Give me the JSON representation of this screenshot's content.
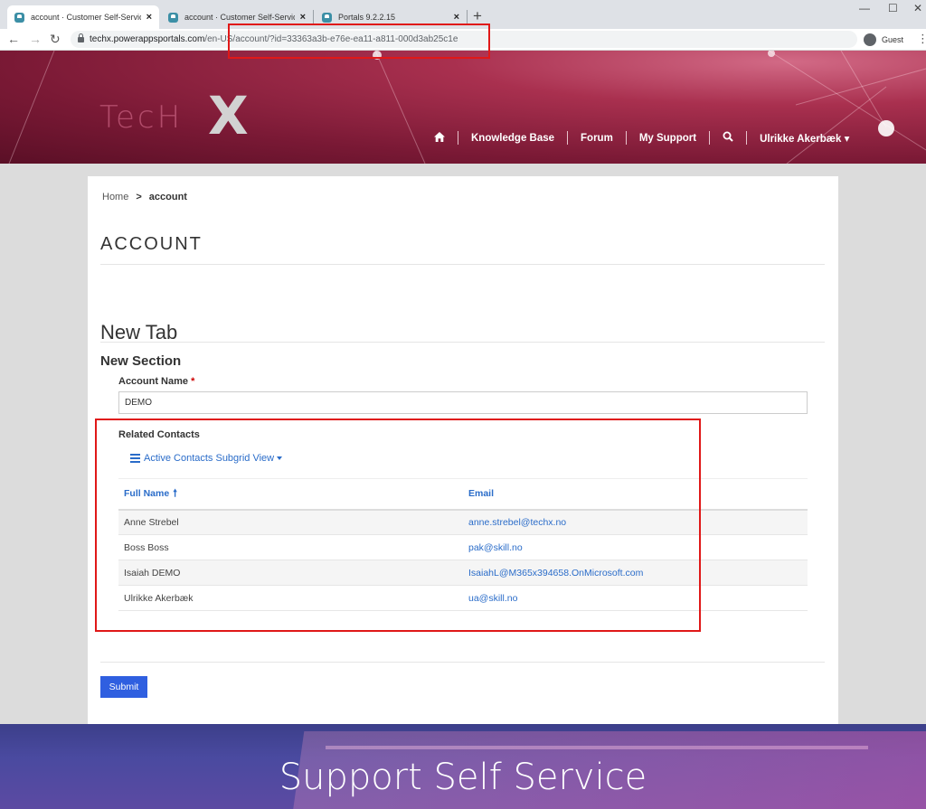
{
  "browser": {
    "tabs": [
      {
        "title": "account · Customer Self-Service",
        "close": "×"
      },
      {
        "title": "account · Customer Self-Service",
        "close": "×"
      },
      {
        "title": "Portals 9.2.2.15",
        "close": "×"
      }
    ],
    "new_tab": "+",
    "window_controls": {
      "minimize": "—",
      "maximize": "☐",
      "close": "✕"
    },
    "nav": {
      "back": "←",
      "forward": "→",
      "reload": "↻"
    },
    "url_host": "techx.powerappsportals.com",
    "url_path": "/en-US/account/?id=33363a3b-e76e-ea11-a811-000d3ab25c1e",
    "profile": "Guest",
    "menu": "⋮"
  },
  "header": {
    "logo_text": "TecH",
    "logo_x": "X",
    "nav": {
      "knowledge_base": "Knowledge Base",
      "forum": "Forum",
      "my_support": "My Support",
      "user": "Ulrikke Akerbæk ▾"
    }
  },
  "breadcrumb": {
    "home": "Home",
    "separator": ">",
    "current": "account"
  },
  "page_title": "ACCOUNT",
  "form": {
    "tab_heading": "New Tab",
    "section_heading": "New Section",
    "account_name_label": "Account Name",
    "required_mark": "*",
    "account_name_value": "DEMO",
    "related_contacts_label": "Related Contacts",
    "view_selector": "Active Contacts Subgrid View",
    "columns": {
      "full_name": "Full Name",
      "email": "Email",
      "sort": "🠕"
    },
    "rows": [
      {
        "name": "Anne Strebel",
        "email": "anne.strebel@techx.no"
      },
      {
        "name": "Boss Boss",
        "email": "pak@skill.no"
      },
      {
        "name": "Isaiah DEMO",
        "email": "IsaiahL@M365x394658.OnMicrosoft.com"
      },
      {
        "name": "Ulrikke Akerbæk",
        "email": "ua@skill.no"
      }
    ],
    "submit": "Submit"
  },
  "footer": {
    "title": "Support Self Service"
  },
  "colors": {
    "header": "#7a1935",
    "link": "#2a6cc9",
    "submit": "#2f5fe0",
    "highlight": "#e01818",
    "footer": "#4a4aa0"
  }
}
